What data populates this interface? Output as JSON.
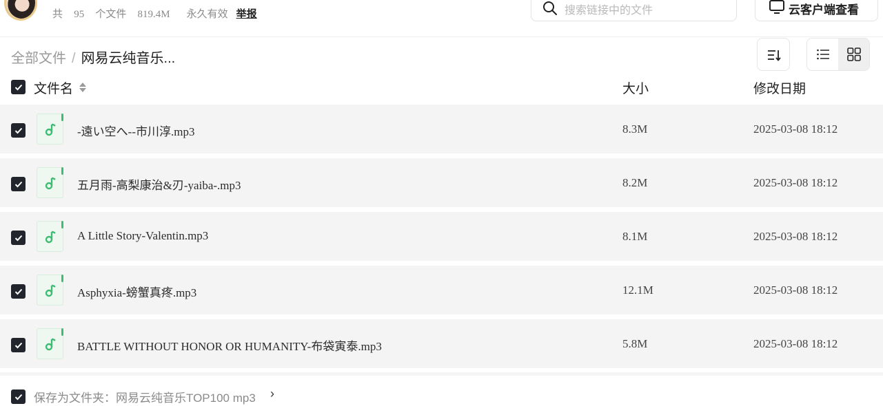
{
  "header": {
    "meta": {
      "count_prefix": "共",
      "count": "95",
      "count_suffix": "个文件",
      "size": "819.4M",
      "validity": "永久有效",
      "report_label": "举报"
    },
    "search": {
      "placeholder": "搜索链接中的文件",
      "icon": "search-icon"
    },
    "client_button": {
      "label": "云客户端查看",
      "icon": "monitor-icon"
    }
  },
  "breadcrumb": {
    "root": "全部文件",
    "separator": "/",
    "current": "网易云纯音乐..."
  },
  "toolbar": {
    "sort_icon": "sort-icon",
    "view_options": [
      {
        "name": "list",
        "icon": "list-view-icon",
        "selected": false
      },
      {
        "name": "grid",
        "icon": "grid-view-icon",
        "selected": true
      }
    ]
  },
  "table": {
    "columns": {
      "name": "文件名",
      "size": "大小",
      "date": "修改日期"
    },
    "rows": [
      {
        "name": "-遠い空へ--市川淳.mp3",
        "size": "8.3M",
        "date": "2025-03-08 18:12",
        "checked": true
      },
      {
        "name": "五月雨-高梨康治&刃-yaiba-.mp3",
        "size": "8.2M",
        "date": "2025-03-08 18:12",
        "checked": true
      },
      {
        "name": "A Little Story-Valentin.mp3",
        "size": "8.1M",
        "date": "2025-03-08 18:12",
        "checked": true
      },
      {
        "name": "Asphyxia-螃蟹真疼.mp3",
        "size": "12.1M",
        "date": "2025-03-08 18:12",
        "checked": true
      },
      {
        "name": "BATTLE WITHOUT HONOR OR HUMANITY-布袋寅泰.mp3",
        "size": "5.8M",
        "date": "2025-03-08 18:12",
        "checked": true
      }
    ]
  },
  "footer": {
    "save_label": "保存为文件夹：网易云纯音乐TOP100 mp3",
    "arrow": "›"
  },
  "colors": {
    "checkbox": "#22252b",
    "row_bg": "#f4f4f4",
    "music_icon": "#3dbd73"
  }
}
